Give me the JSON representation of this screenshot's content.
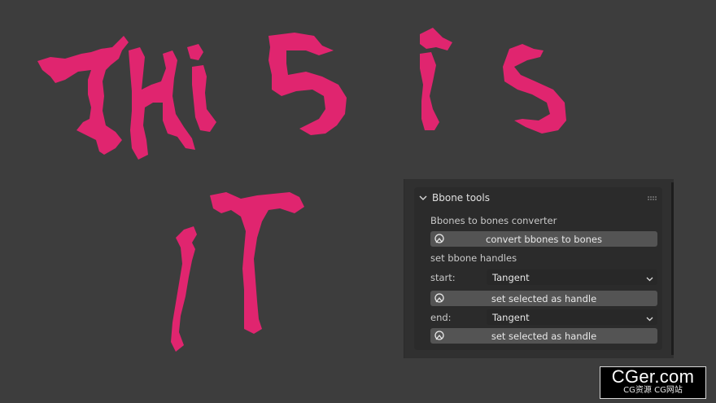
{
  "viewport": {
    "background": "#3d3d3d",
    "drawing_color": "#e0256f",
    "drawing_line1": "ThiS is",
    "drawing_line2": "IT"
  },
  "panel": {
    "title": "Bbone tools",
    "section1_label": "Bbones to bones converter",
    "convert_button": "convert bbones to bones",
    "section2_label": "set bbone handles",
    "start_label": "start:",
    "start_value": "Tangent",
    "start_button": "set selected as handle",
    "end_label": "end:",
    "end_value": "Tangent",
    "end_button": "set selected as handle",
    "icons": {
      "collapse": "chevron-down-icon",
      "grip": "grip-dots-icon",
      "button": "bone-pointer-icon",
      "dropdown": "chevron-down-icon"
    }
  },
  "watermark": {
    "main": "CGer.com",
    "sub": "CG资源 CG网站"
  }
}
